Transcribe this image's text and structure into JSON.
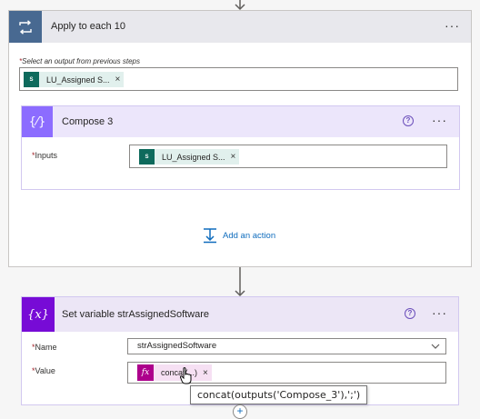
{
  "top_arrow": "down-arrow-icon",
  "apply_each": {
    "title": "Apply to each 10",
    "icon": "loop-icon",
    "more": "···",
    "select_label": "Select an output from previous steps",
    "required_mark": "*",
    "token_text": "LU_Assigned S...",
    "token_icon": "sharepoint-icon",
    "token_close": "×"
  },
  "compose": {
    "title": "Compose 3",
    "icon": "compose-icon",
    "icon_glyph": "{⁄}",
    "help": "?",
    "more": "···",
    "inputs_label": "Inputs",
    "required_mark": "*",
    "token_text": "LU_Assigned S...",
    "token_close": "×"
  },
  "add_action": {
    "label": "Add an action",
    "icon": "add-action-icon"
  },
  "set_variable": {
    "title": "Set variable strAssignedSoftware",
    "icon_glyph": "{x}",
    "help": "?",
    "more": "···",
    "name_label": "Name",
    "name_value": "strAssignedSoftware",
    "value_label": "Value",
    "required_mark": "*",
    "fx_glyph": "fx",
    "expr_token": "concat(...)",
    "expr_close": "×",
    "tooltip": "concat(outputs('Compose_3'),';')"
  },
  "colors": {
    "apply_header": "#e8e8ed",
    "apply_icon_bg": "#486991",
    "compose_header": "#ece6fb",
    "compose_icon_bg": "#8c6cff",
    "variable_header": "#ece6f6",
    "variable_icon_bg": "#770bd6",
    "fx_bg": "#ad008c",
    "link": "#0f6cbd"
  }
}
